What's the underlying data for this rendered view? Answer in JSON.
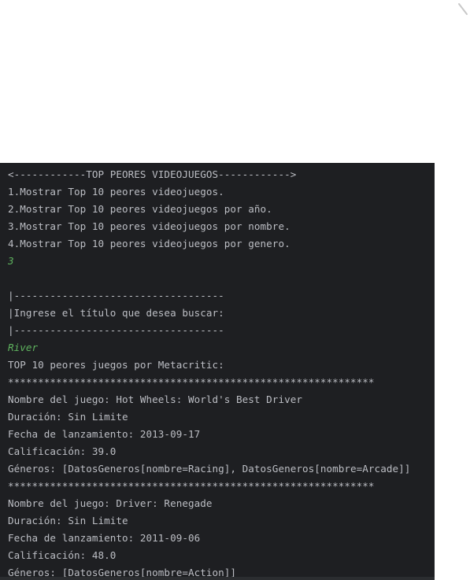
{
  "console": {
    "lines": [
      {
        "text": "<------------TOP PEORES VIDEOJUEGOS------------>",
        "kind": "output"
      },
      {
        "text": "1.Mostrar Top 10 peores videojuegos.",
        "kind": "output"
      },
      {
        "text": "2.Mostrar Top 10 peores videojuegos por año.",
        "kind": "output"
      },
      {
        "text": "3.Mostrar Top 10 peores videojuegos por nombre.",
        "kind": "output"
      },
      {
        "text": "4.Mostrar Top 10 peores videojuegos por genero.",
        "kind": "output"
      },
      {
        "text": "3",
        "kind": "input"
      },
      {
        "text": "",
        "kind": "output"
      },
      {
        "text": "|-----------------------------------",
        "kind": "output"
      },
      {
        "text": "|Ingrese el título que desea buscar:",
        "kind": "output"
      },
      {
        "text": "|-----------------------------------",
        "kind": "output"
      },
      {
        "text": "River",
        "kind": "input"
      },
      {
        "text": "TOP 10 peores juegos por Metacritic:",
        "kind": "output"
      },
      {
        "text": "*************************************************************",
        "kind": "output"
      },
      {
        "text": "Nombre del juego: Hot Wheels: World's Best Driver",
        "kind": "output"
      },
      {
        "text": "Duración: Sin Limite",
        "kind": "output"
      },
      {
        "text": "Fecha de lanzamiento: 2013-09-17",
        "kind": "output"
      },
      {
        "text": "Calificación: 39.0",
        "kind": "output"
      },
      {
        "text": "Géneros: [DatosGeneros[nombre=Racing], DatosGeneros[nombre=Arcade]]",
        "kind": "output"
      },
      {
        "text": "*************************************************************",
        "kind": "output"
      },
      {
        "text": "Nombre del juego: Driver: Renegade",
        "kind": "output"
      },
      {
        "text": "Duración: Sin Limite",
        "kind": "output"
      },
      {
        "text": "Fecha de lanzamiento: 2011-09-06",
        "kind": "output"
      },
      {
        "text": "Calificación: 48.0",
        "kind": "output"
      },
      {
        "text": "Géneros: [DatosGeneros[nombre=Action]]",
        "kind": "output"
      }
    ]
  },
  "colors": {
    "console_background": "#1e1f22",
    "output_text": "#bcbec4",
    "user_input_text": "#5fb45f"
  }
}
